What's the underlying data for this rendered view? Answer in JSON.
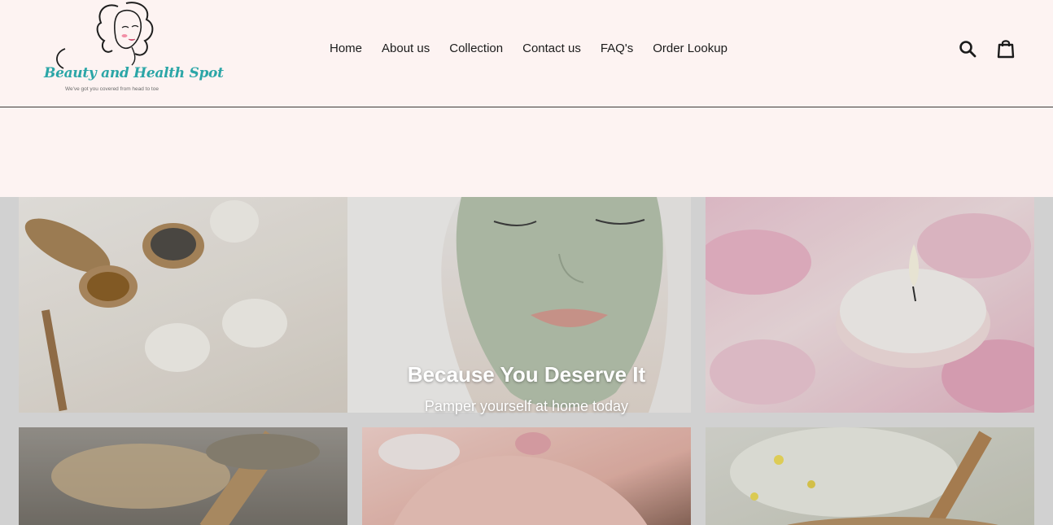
{
  "logo": {
    "brand": "Beauty and Health Spot",
    "tagline": "We've got you covered from head to toe"
  },
  "nav": {
    "items": [
      {
        "label": "Home"
      },
      {
        "label": "About us"
      },
      {
        "label": "Collection"
      },
      {
        "label": "Contact us"
      },
      {
        "label": "FAQ's"
      },
      {
        "label": "Order Lookup"
      }
    ]
  },
  "header_icons": {
    "search": "search-icon",
    "cart": "cart-icon"
  },
  "hero": {
    "title": "Because You Deserve It",
    "subtitle": "Pamper yourself at home today"
  },
  "colors": {
    "header_bg": "#fdf3f2",
    "brand_teal": "#2ba6a7",
    "hero_text": "#ffffff"
  }
}
